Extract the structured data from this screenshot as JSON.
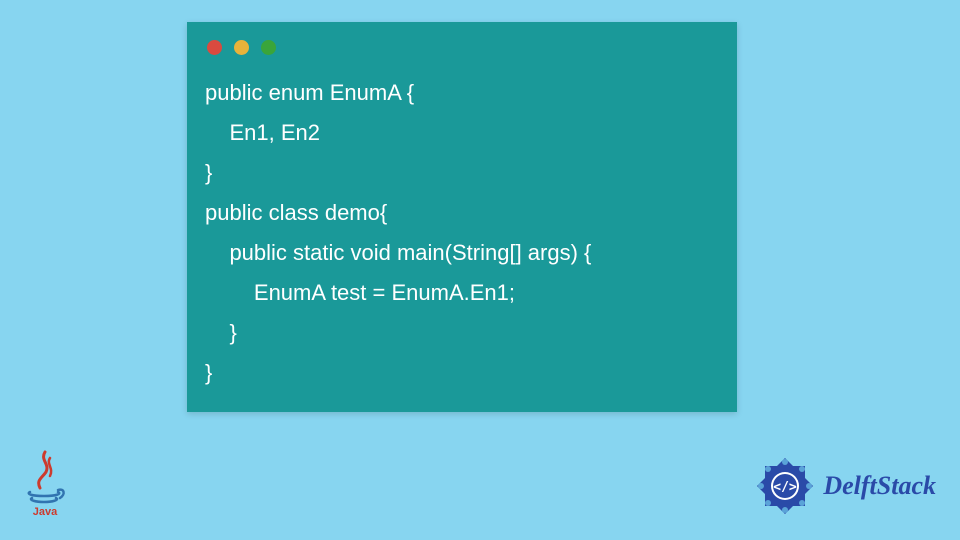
{
  "window": {
    "dots": [
      "red",
      "yellow",
      "green"
    ]
  },
  "code": {
    "lines": [
      "public enum EnumA {",
      "    En1, En2",
      "}",
      "public class demo{",
      "    public static void main(String[] args) {",
      "        EnumA test = EnumA.En1;",
      "    }",
      "}"
    ]
  },
  "logos": {
    "java_label": "Java",
    "delft_text": "DelftStack"
  },
  "colors": {
    "background": "#87d5f0",
    "window_bg": "#1a9999",
    "code_text": "#ffffff",
    "delft_blue": "#2a4aa8",
    "java_red": "#cc3b2e",
    "java_blue": "#3174b0"
  }
}
